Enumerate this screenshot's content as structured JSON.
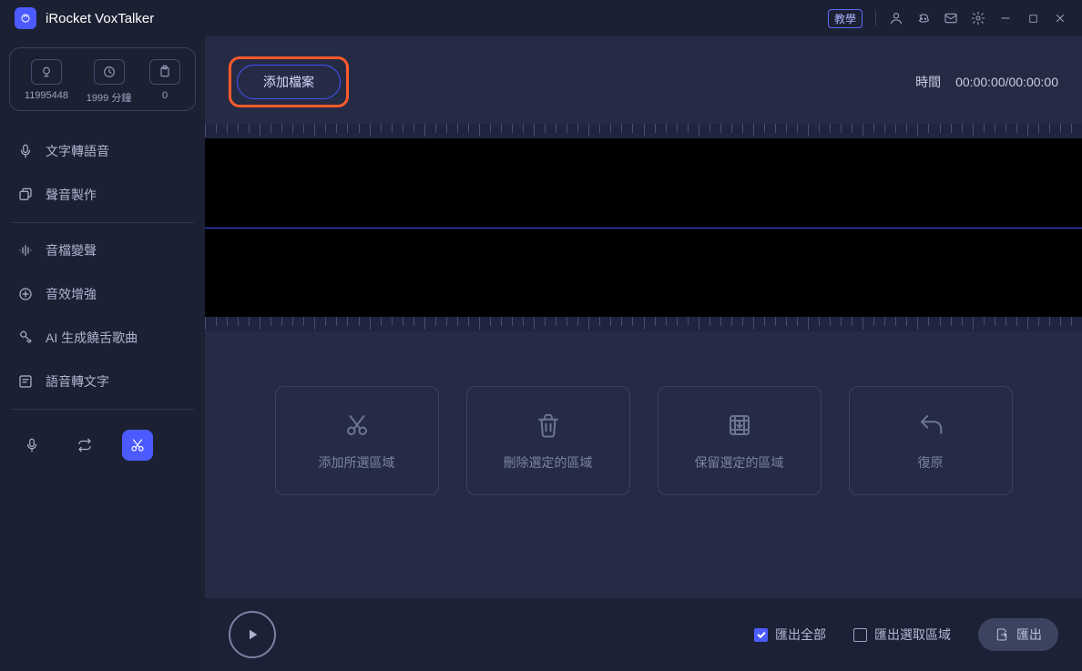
{
  "app": {
    "title": "iRocket VoxTalker"
  },
  "titlebar": {
    "tutorial_label": "教學"
  },
  "credits": {
    "items": [
      {
        "value": "11995448"
      },
      {
        "value": "1999 分鐘"
      },
      {
        "value": "0"
      }
    ]
  },
  "nav": {
    "items": [
      {
        "label": "文字轉語音"
      },
      {
        "label": "聲音製作"
      },
      {
        "label": "音檔變聲"
      },
      {
        "label": "音效增強"
      },
      {
        "label": "AI 生成饒舌歌曲"
      },
      {
        "label": "語音轉文字"
      }
    ]
  },
  "toolbar": {
    "add_file_label": "添加檔案"
  },
  "time": {
    "label": "時間",
    "value": "00:00:00/00:00:00"
  },
  "actions": {
    "items": [
      {
        "label": "添加所選區域"
      },
      {
        "label": "刪除選定的區域"
      },
      {
        "label": "保留選定的區域"
      },
      {
        "label": "復原"
      }
    ]
  },
  "bottom": {
    "export_all_label": "匯出全部",
    "export_selection_label": "匯出選取區域",
    "export_btn_label": "匯出"
  }
}
